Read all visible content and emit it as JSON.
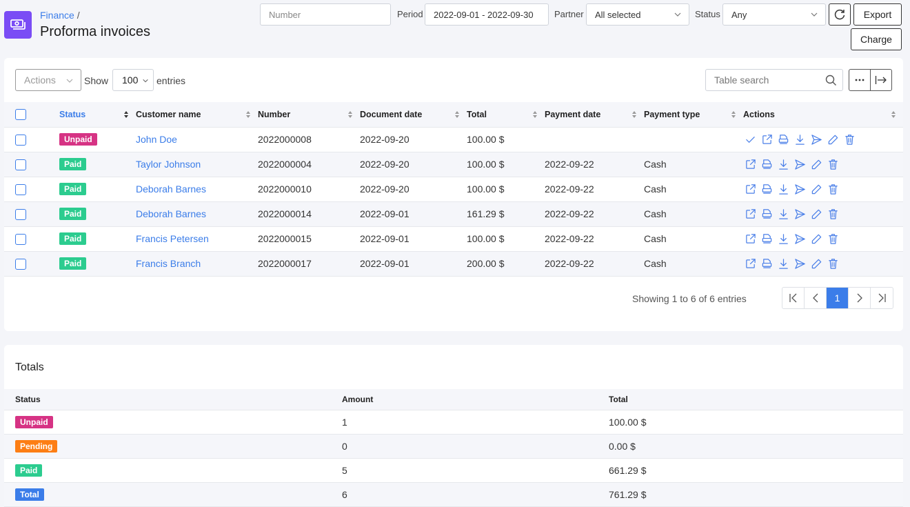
{
  "header": {
    "breadcrumb_parent": "Finance",
    "breadcrumb_separator": "/",
    "title": "Proforma invoices",
    "app_icon": "money-icon"
  },
  "filters": {
    "number_placeholder": "Number",
    "period_label": "Period",
    "period_value": "2022-09-01 - 2022-09-30",
    "partner_label": "Partner",
    "partner_value": "All selected",
    "status_label": "Status",
    "status_value": "Any",
    "refresh_icon": "refresh-icon",
    "export_label": "Export",
    "charge_label": "Charge"
  },
  "toolbar": {
    "actions_label": "Actions",
    "show_label": "Show",
    "entries_value": "100",
    "entries_label": "entries",
    "search_placeholder": "Table search"
  },
  "table": {
    "columns": [
      "Status",
      "Customer name",
      "Number",
      "Document date",
      "Total",
      "Payment date",
      "Payment type",
      "Actions"
    ],
    "rows": [
      {
        "status": "Unpaid",
        "customer": "John Doe",
        "number": "2022000008",
        "doc_date": "2022-09-20",
        "total": "100.00 $",
        "pay_date": "",
        "pay_type": ""
      },
      {
        "status": "Paid",
        "customer": "Taylor Johnson",
        "number": "2022000004",
        "doc_date": "2022-09-20",
        "total": "100.00 $",
        "pay_date": "2022-09-22",
        "pay_type": "Cash"
      },
      {
        "status": "Paid",
        "customer": "Deborah Barnes",
        "number": "2022000010",
        "doc_date": "2022-09-20",
        "total": "100.00 $",
        "pay_date": "2022-09-22",
        "pay_type": "Cash"
      },
      {
        "status": "Paid",
        "customer": "Deborah Barnes",
        "number": "2022000014",
        "doc_date": "2022-09-01",
        "total": "161.29 $",
        "pay_date": "2022-09-22",
        "pay_type": "Cash"
      },
      {
        "status": "Paid",
        "customer": "Francis Petersen",
        "number": "2022000015",
        "doc_date": "2022-09-01",
        "total": "100.00 $",
        "pay_date": "2022-09-22",
        "pay_type": "Cash"
      },
      {
        "status": "Paid",
        "customer": "Francis Branch",
        "number": "2022000017",
        "doc_date": "2022-09-01",
        "total": "200.00 $",
        "pay_date": "2022-09-22",
        "pay_type": "Cash"
      }
    ]
  },
  "pagination": {
    "summary": "Showing 1 to 6 of 6 entries",
    "current_page": "1"
  },
  "totals": {
    "title": "Totals",
    "columns": [
      "Status",
      "Amount",
      "Total"
    ],
    "rows": [
      {
        "status": "Unpaid",
        "amount": "1",
        "total": "100.00 $"
      },
      {
        "status": "Pending",
        "amount": "0",
        "total": "0.00 $"
      },
      {
        "status": "Paid",
        "amount": "5",
        "total": "661.29 $"
      },
      {
        "status": "Total",
        "amount": "6",
        "total": "761.29 $"
      }
    ]
  },
  "colors": {
    "accent": "#3b7de9",
    "unpaid": "#d63384",
    "paid": "#2ccc8f",
    "pending": "#fd7e14",
    "total": "#3b7de9",
    "app_icon_bg": "#7a4cf5"
  }
}
